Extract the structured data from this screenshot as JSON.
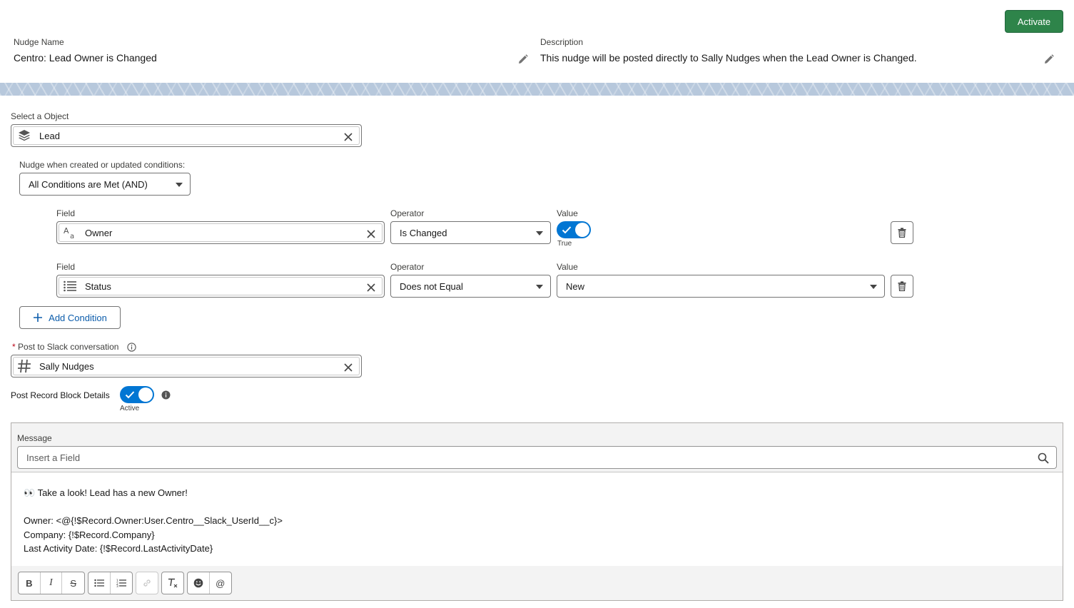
{
  "header": {
    "nudge_name_label": "Nudge Name",
    "nudge_name_value": "Centro: Lead Owner is Changed",
    "description_label": "Description",
    "description_value": "This nudge will be posted directly to Sally Nudges when the Lead Owner is Changed.",
    "activate_label": "Activate"
  },
  "object": {
    "label": "Select a Object",
    "value": "Lead",
    "icon": "stacked-layers-icon"
  },
  "conditions": {
    "logic_label": "Nudge when created or updated conditions:",
    "logic_value": "All Conditions are Met (AND)",
    "rows": [
      {
        "field_label": "Field",
        "field_value": "Owner",
        "field_icon": "text-field-icon",
        "operator_label": "Operator",
        "operator_value": "Is Changed",
        "value_label": "Value",
        "value_toggle_text": "True",
        "value_toggle_on": true
      },
      {
        "field_label": "Field",
        "field_value": "Status",
        "field_icon": "picklist-icon",
        "operator_label": "Operator",
        "operator_value": "Does not Equal",
        "value_label": "Value",
        "value_value": "New"
      }
    ],
    "add_label": "Add Condition"
  },
  "slack": {
    "required_mark": "*",
    "label": "Post to Slack conversation",
    "value": "Sally Nudges",
    "icon": "hash-icon"
  },
  "record_block": {
    "label": "Post Record Block Details",
    "toggle_text": "Active",
    "toggle_on": true
  },
  "message": {
    "label": "Message",
    "search_placeholder": "Insert a Field",
    "lines": [
      "👀 Take a look! Lead has a new Owner!",
      "",
      "Owner: <@{!$Record.Owner:User.Centro__Slack_UserId__c}>",
      "Company: {!$Record.Company}",
      "Last Activity Date: {!$Record.LastActivityDate}"
    ],
    "toolbar": {
      "bold": "B",
      "italic": "I",
      "strike": "S",
      "mention": "@"
    }
  },
  "colors": {
    "brand_blue": "#0176d3",
    "activate_green": "#2e844a",
    "link_blue": "#0b5cab"
  }
}
